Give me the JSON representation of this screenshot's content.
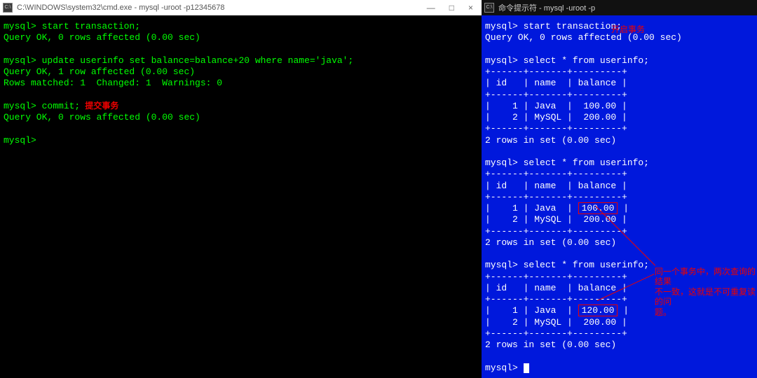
{
  "left": {
    "title": "C:\\WINDOWS\\system32\\cmd.exe - mysql  -uroot -p12345678",
    "icon_label": "C:\\",
    "winbtns": {
      "min": "—",
      "max": "□",
      "close": "×"
    },
    "lines": {
      "p1": "mysql> ",
      "cmd1": "start transaction;",
      "res1": "Query OK, 0 rows affected (0.00 sec)",
      "p2": "mysql> ",
      "cmd2": "update userinfo set balance=balance+20 where name='java';",
      "res2a": "Query OK, 1 row affected (0.00 sec)",
      "res2b": "Rows matched: 1  Changed: 1  Warnings: 0",
      "p3": "mysql> ",
      "cmd3": "commit;",
      "annot3": " 提交事务",
      "res3": "Query OK, 0 rows affected (0.00 sec)",
      "p4": "mysql>"
    }
  },
  "right": {
    "title": "命令提示符 - mysql  -uroot -p",
    "icon_label": "C:\\",
    "annot_open": "开启事务",
    "annot_explain1": "同一个事务中，两次查询的结果",
    "annot_explain2": "不一致，这就是不可重复读的问",
    "annot_explain3": "题。",
    "lines": {
      "p1": "mysql> ",
      "cmd1": "start transaction;",
      "res1": "Query OK, 0 rows affected (0.00 sec)",
      "p2": "mysql> ",
      "cmd2": "select * from userinfo;",
      "table1": {
        "border_top": "+------+-------+---------+",
        "header": "| id   | name  | balance |",
        "border_mid": "+------+-------+---------+",
        "row1": "|    1 | Java  |  100.00 |",
        "row2": "|    2 | MySQL |  200.00 |",
        "border_bot": "+------+-------+---------+"
      },
      "res2": "2 rows in set (0.00 sec)",
      "p3": "mysql> ",
      "cmd3": "select * from userinfo;",
      "table2": {
        "border_top": "+------+-------+---------+",
        "header": "| id   | name  | balance |",
        "border_mid": "+------+-------+---------+",
        "row1_pre": "|    1 | Java  | ",
        "row1_val": "100.00",
        "row1_post": " |",
        "row2": "|    2 | MySQL |  200.00 |",
        "border_bot": "+------+-------+---------+"
      },
      "res3": "2 rows in set (0.00 sec)",
      "p4": "mysql> ",
      "cmd4": "select * from userinfo;",
      "table3": {
        "border_top": "+------+-------+---------+",
        "header": "| id   | name  | balance |",
        "border_mid": "+------+-------+---------+",
        "row1_pre": "|    1 | Java  | ",
        "row1_val": "120.00",
        "row1_post": " |",
        "row2": "|    2 | MySQL |  200.00 |",
        "border_bot": "+------+-------+---------+"
      },
      "res4": "2 rows in set (0.00 sec)",
      "p5": "mysql> "
    }
  }
}
